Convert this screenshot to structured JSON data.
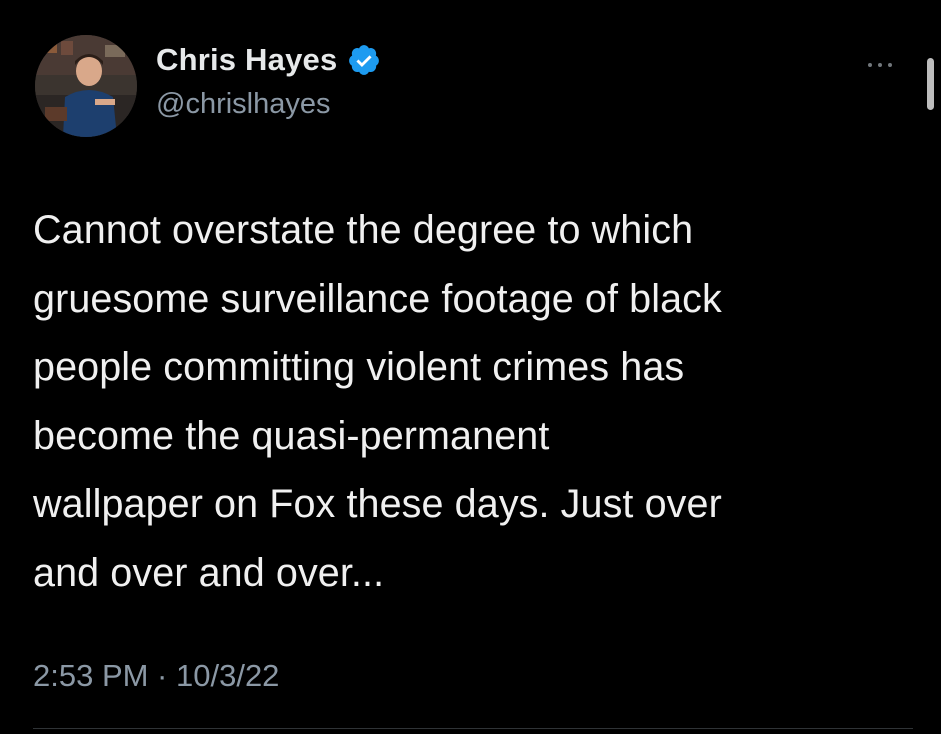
{
  "user": {
    "display_name": "Chris Hayes",
    "handle": "@chrislhayes",
    "verified_icon": "verified-badge-icon",
    "verified_color": "#1d9bf0"
  },
  "tweet": {
    "text_lines": [
      "Cannot overstate the degree to which",
      "gruesome surveillance footage of black",
      "people committing violent crimes has",
      "become the quasi-permanent",
      "wallpaper on Fox these days. Just over",
      "and over and over..."
    ],
    "timestamp": "2:53 PM · 10/3/22"
  },
  "menu": {
    "icon": "more-options-icon"
  },
  "colors": {
    "background": "#000000",
    "text": "#e7e9ea",
    "secondary_text": "#8b98a5"
  }
}
